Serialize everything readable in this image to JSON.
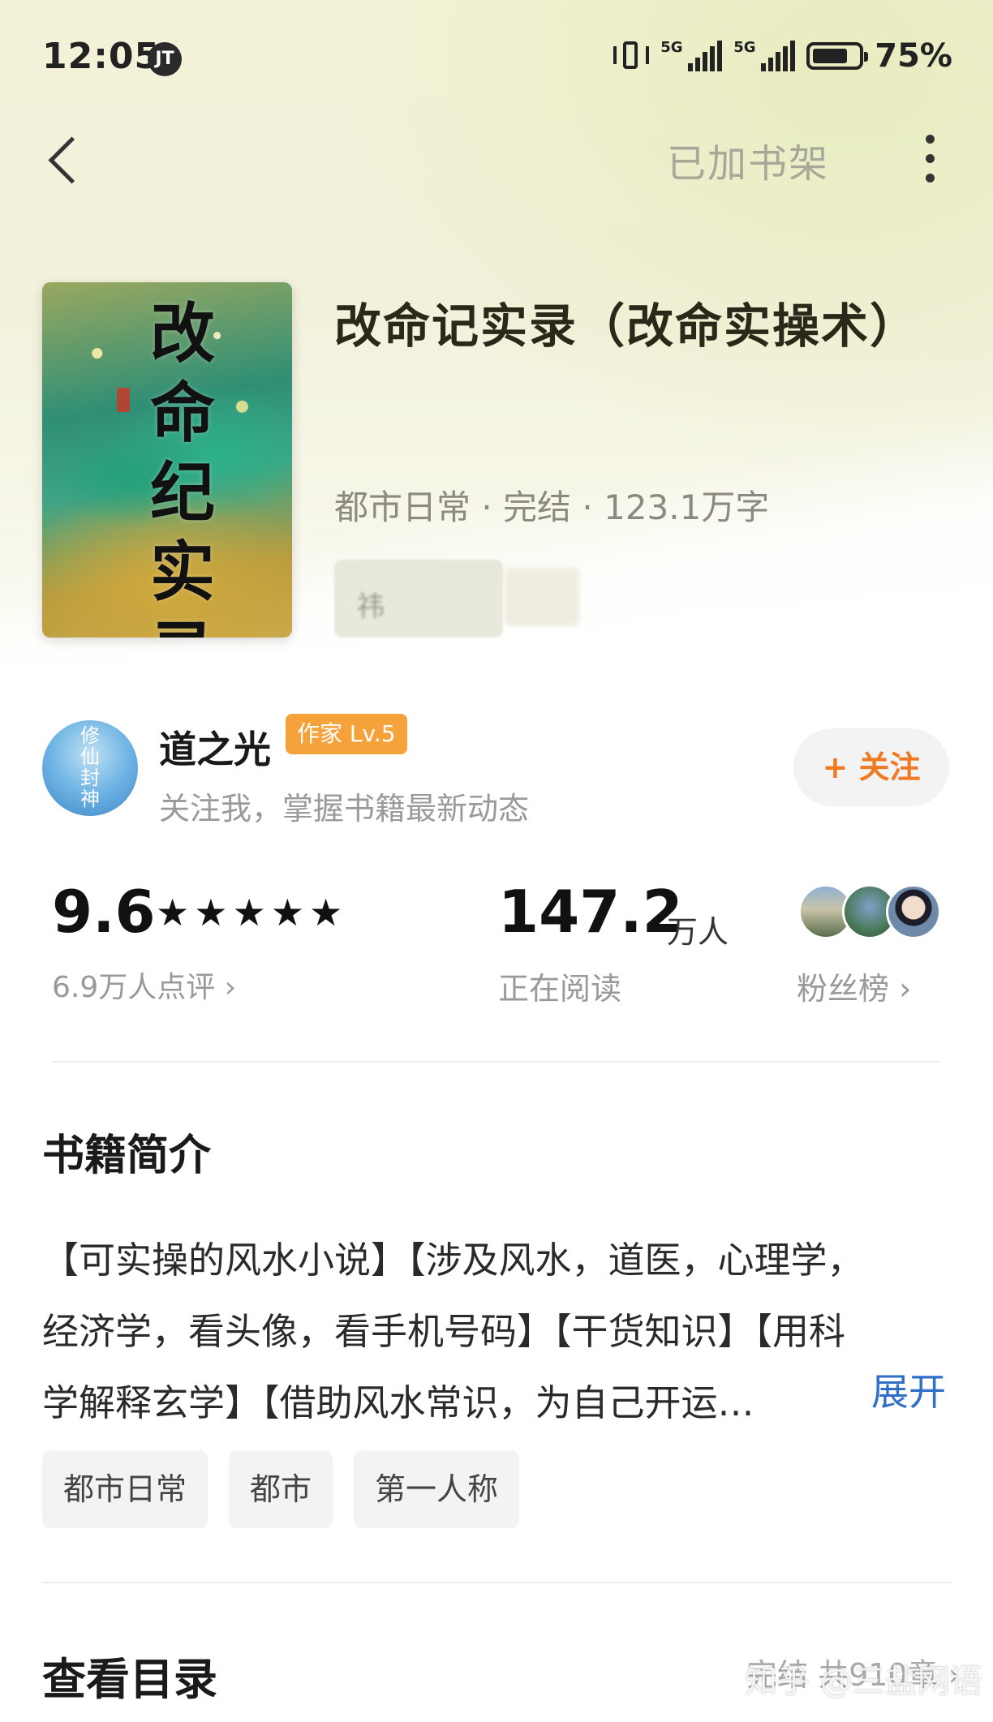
{
  "status_bar": {
    "time": "12:05",
    "time_badge": "JT",
    "net1": "5G",
    "net2": "5G",
    "battery": "75%"
  },
  "nav": {
    "shelf_label": "已加书架"
  },
  "book": {
    "cover_title": "改命纪实录",
    "title": "改命记实录（改命实操术）",
    "meta": "都市日常 · 完结 · 123.1万字",
    "blurred_char": "祎"
  },
  "author": {
    "avatar_text": "修仙封神",
    "name": "道之光",
    "badge": "作家 Lv.5",
    "subtitle": "关注我，掌握书籍最新动态",
    "follow_label": "+ 关注"
  },
  "stats": {
    "rating": "9.6",
    "stars": "★★★★★",
    "rating_count": "6.9万人点评 ›",
    "readers": "147.2",
    "readers_unit": "万人",
    "readers_label": "正在阅读",
    "fans_label": "粉丝榜 ›"
  },
  "intro": {
    "title": "书籍简介",
    "lines": [
      "【可实操的风水小说】【涉及风水，道医，心理学，",
      "经济学，看头像，看手机号码】【干货知识】【用科",
      "学解释玄学】【借助风水常识，为自己开运…"
    ],
    "expand_label": "展开"
  },
  "tags": [
    "都市日常",
    "都市",
    "第一人称"
  ],
  "toc": {
    "title": "查看目录",
    "status": "完结 共910章 ›"
  },
  "watermark": "知乎 @三盐网语",
  "colors": {
    "accent_orange": "#f07a24",
    "badge_orange": "#f6a23b",
    "link_blue": "#2f6fc7"
  }
}
